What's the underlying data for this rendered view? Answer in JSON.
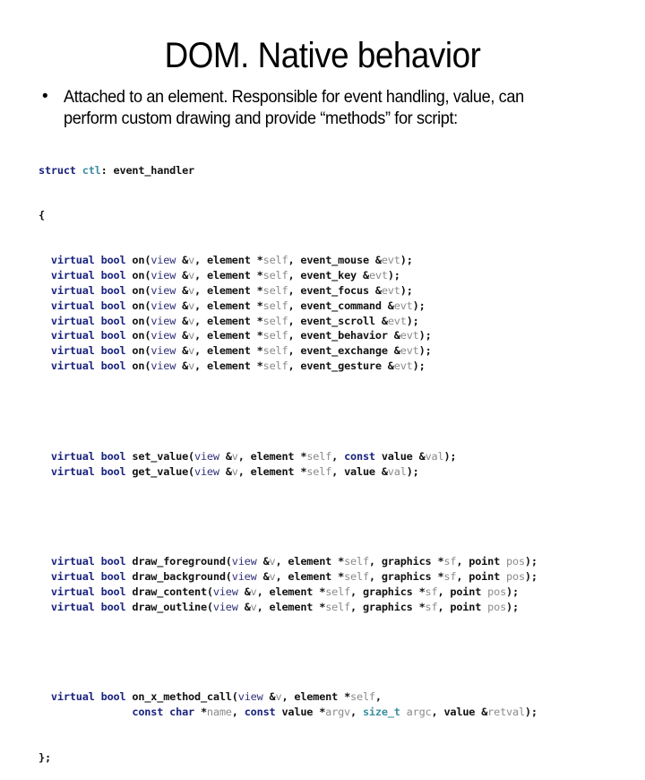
{
  "slide": {
    "title": "DOM. Native behavior",
    "bullet": {
      "marker": "•",
      "line1": "Attached to an element. Responsible for event handling, value, can",
      "line2": "perform custom drawing and provide “methods” for script:"
    }
  },
  "code": {
    "header": {
      "kw_struct": "struct",
      "name": "ctl",
      "rest": ": event_handler"
    },
    "open_brace": "{",
    "event_handlers": [
      "event_mouse",
      "event_key",
      "event_focus",
      "event_command",
      "event_scroll",
      "event_behavior",
      "event_exchange",
      "event_gesture"
    ],
    "value_methods": [
      {
        "name": "set_value",
        "const_kw": "const ",
        "type": "value",
        "param": "val"
      },
      {
        "name": "get_value",
        "const_kw": "",
        "type": "value",
        "param": "val"
      }
    ],
    "draw_methods": [
      {
        "name": "draw_foreground"
      },
      {
        "name": "draw_background"
      },
      {
        "name": "draw_content"
      },
      {
        "name": "draw_outline"
      }
    ],
    "method_call": {
      "name": "on_x_method_call",
      "line2": {
        "const1": "const",
        "char": "char",
        "name_param": "name",
        "const2": "const",
        "value_type": "value",
        "argv": "argv",
        "size_t": "size_t",
        "argc": "argc",
        "value_type2": "value",
        "retval": "retval"
      }
    },
    "close": "};",
    "tokens": {
      "virtual": "virtual",
      "bool": "bool",
      "on": "on(",
      "view": "view",
      "v": "v",
      "element": "element",
      "self": "self",
      "evt": "evt",
      "graphics": "graphics",
      "sf": "sf",
      "point": "point",
      "pos": "pos"
    }
  }
}
